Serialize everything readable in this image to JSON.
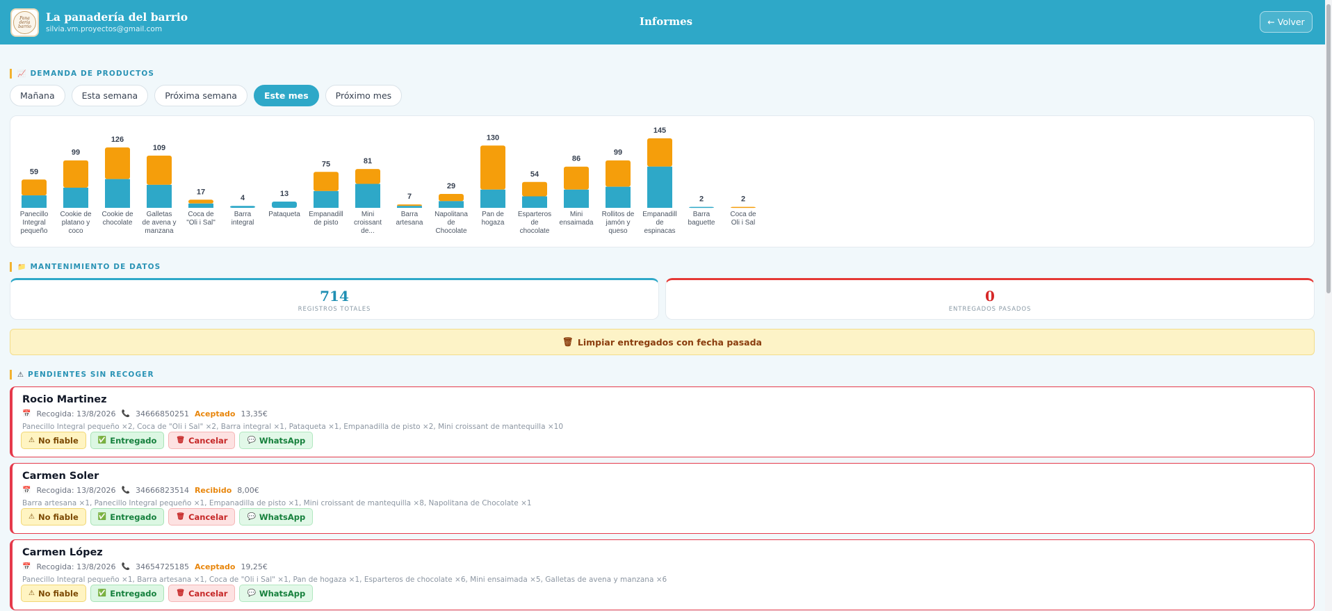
{
  "header": {
    "app_name": "La panadería del barrio",
    "email": "silvia.vm.proyectos@gmail.com",
    "page_title": "Informes",
    "back_label": "← Volver",
    "logo_text": "Panadería del barrio"
  },
  "demand": {
    "section_title": "DEMANDA DE PRODUCTOS",
    "section_icon": "chart-icon",
    "tabs": [
      "Mañana",
      "Esta semana",
      "Próxima semana",
      "Este mes",
      "Próximo mes"
    ],
    "active_tab": "Este mes"
  },
  "chart_data": {
    "type": "bar",
    "stacked": true,
    "title": "",
    "xlabel": "",
    "ylabel": "",
    "colors": {
      "bottom": "#2ea8c8",
      "top": "#f59e0b"
    },
    "categories": [
      [
        "Panecillo",
        "Integral",
        "pequeño"
      ],
      [
        "Cookie de",
        "platano y",
        "coco"
      ],
      [
        "Cookie de",
        "chocolate"
      ],
      [
        "Galletas",
        "de avena y",
        "manzana"
      ],
      [
        "Coca de",
        "\"Oli i Sal\""
      ],
      [
        "Barra",
        "integral"
      ],
      [
        "Pataqueta"
      ],
      [
        "Empanadill",
        "de pisto"
      ],
      [
        "Mini",
        "croissant",
        "de..."
      ],
      [
        "Barra",
        "artesana"
      ],
      [
        "Napolitana",
        "de",
        "Chocolate"
      ],
      [
        "Pan de",
        "hogaza"
      ],
      [
        "Esparteros",
        "de",
        "chocolate"
      ],
      [
        "Mini",
        "ensaimada"
      ],
      [
        "Rollitos de",
        "jamón y",
        "queso"
      ],
      [
        "Empanadill",
        "de",
        "espinacas"
      ],
      [
        "Barra",
        "baguette"
      ],
      [
        "Coca de",
        "Oli i Sal"
      ]
    ],
    "series": [
      {
        "values": [
          26,
          42,
          60,
          48,
          9,
          4,
          13,
          35,
          50,
          4,
          14,
          38,
          24,
          38,
          44,
          86,
          2,
          0
        ]
      },
      {
        "values": [
          33,
          57,
          66,
          61,
          8,
          0,
          0,
          40,
          31,
          3,
          15,
          92,
          30,
          48,
          55,
          59,
          0,
          2
        ]
      }
    ],
    "totals": [
      59,
      99,
      126,
      109,
      17,
      4,
      13,
      75,
      81,
      7,
      29,
      130,
      54,
      86,
      99,
      145,
      2,
      2
    ],
    "ylim": [
      0,
      145
    ]
  },
  "maintenance": {
    "section_title": "MANTENIMIENTO DE DATOS",
    "section_icon": "folder-icon",
    "total_records": "714",
    "total_records_label": "REGISTROS TOTALES",
    "past_delivered": "0",
    "past_delivered_label": "ENTREGADOS PASADOS",
    "clean_label": "Limpiar entregados con fecha pasada",
    "clean_icon": "trash-icon"
  },
  "pending": {
    "section_title": "PENDIENTES SIN RECOGER",
    "section_icon": "warning-icon",
    "action_labels": {
      "unreliable": "No fiable",
      "delivered": "Entregado",
      "cancel": "Cancelar",
      "whatsapp": "WhatsApp"
    },
    "orders": [
      {
        "name": "Rocio Martinez",
        "pickup": "Recogida: 13/8/2026",
        "phone": "34666850251",
        "status": "Aceptado",
        "amount": "13,35€",
        "items": "Panecillo Integral pequeño ×2, Coca de \"Oli i Sal\" ×2, Barra integral ×1, Pataqueta ×1, Empanadilla de pisto ×2, Mini croissant de mantequilla ×10"
      },
      {
        "name": "Carmen Soler",
        "pickup": "Recogida: 13/8/2026",
        "phone": "34666823514",
        "status": "Recibido",
        "amount": "8,00€",
        "items": "Barra artesana ×1, Panecillo Integral pequeño ×1, Empanadilla de pisto ×1, Mini croissant de mantequilla ×8, Napolitana de Chocolate ×1"
      },
      {
        "name": "Carmen López",
        "pickup": "Recogida: 13/8/2026",
        "phone": "34654725185",
        "status": "Aceptado",
        "amount": "19,25€",
        "items": "Panecillo Integral pequeño ×1, Barra artesana ×1, Coca de \"Oli i Sal\" ×1, Pan de hogaza ×1, Esparteros de chocolate ×6, Mini ensaimada ×5, Galletas de avena y manzana ×6"
      }
    ]
  }
}
